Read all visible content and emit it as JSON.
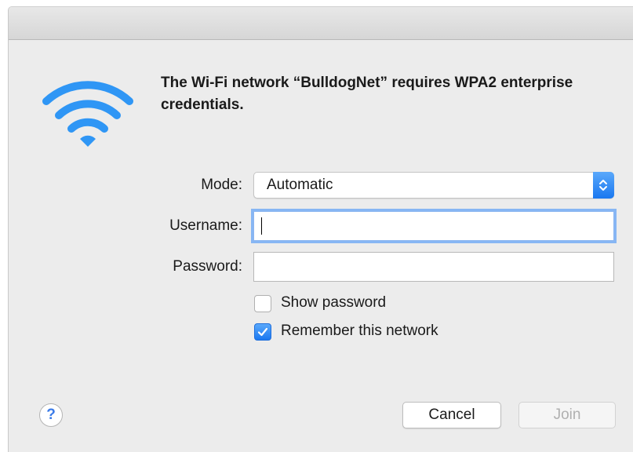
{
  "dialog": {
    "message": "The Wi-Fi network “BulldogNet” requires WPA2 enterprise credentials.",
    "icon": "wifi-icon"
  },
  "form": {
    "mode_label": "Mode:",
    "mode_value": "Automatic",
    "username_label": "Username:",
    "username_value": "",
    "password_label": "Password:",
    "password_value": ""
  },
  "options": {
    "show_password_label": "Show password",
    "show_password_checked": false,
    "remember_label": "Remember this network",
    "remember_checked": true
  },
  "buttons": {
    "help_label": "?",
    "cancel_label": "Cancel",
    "join_label": "Join",
    "join_enabled": false
  },
  "colors": {
    "accent": "#1a78f0",
    "wifi_icon": "#2f96f5",
    "focus_ring": "#87b6f4"
  }
}
